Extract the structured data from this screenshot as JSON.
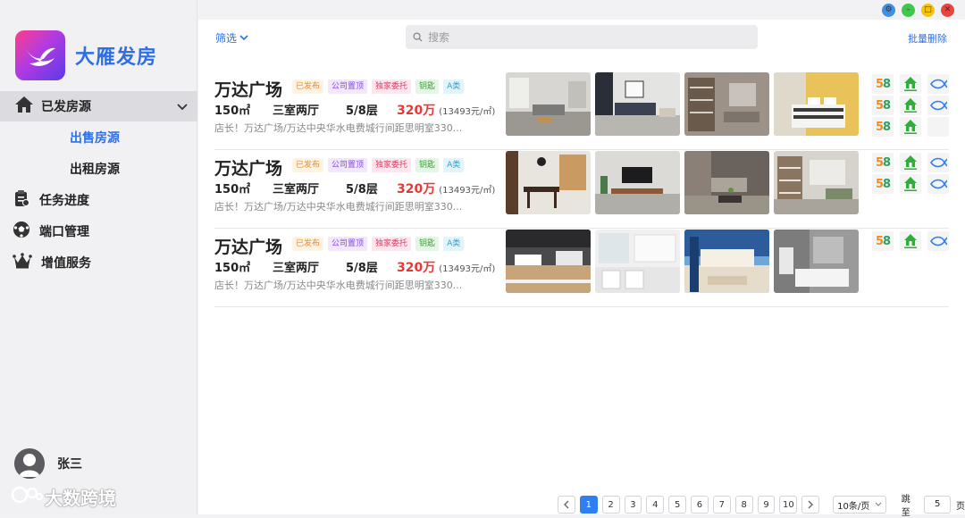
{
  "window": {
    "controls": [
      {
        "name": "settings-window-button",
        "color": "#3d8fe8",
        "glyph": "⚙"
      },
      {
        "name": "minimize-window-button",
        "color": "#3fc74a",
        "glyph": "–"
      },
      {
        "name": "maximize-window-button",
        "color": "#f2c40f",
        "glyph": "□"
      },
      {
        "name": "close-window-button",
        "color": "#e8453c",
        "glyph": "✕"
      }
    ]
  },
  "sidebar": {
    "brand": "大雁发房",
    "nav": {
      "group_label": "已发房源",
      "sub_items": [
        "出售房源",
        "出租房源"
      ],
      "items": [
        "任务进度",
        "端口管理",
        "增值服务"
      ]
    },
    "user_name": "张三",
    "watermark": "大数跨境"
  },
  "toolbar": {
    "filter_label": "筛选",
    "search_placeholder": "搜索",
    "bulk_delete_label": "批量删除"
  },
  "listings": [
    {
      "title": "万达广场",
      "tags": [
        "已发布",
        "公司置顶",
        "独家委托",
        "钥匙",
        "A类"
      ],
      "area": "150㎡",
      "layout": "三室两厅",
      "floor": "5/8层",
      "price": "320万",
      "unit_price": "(13493元/㎡)",
      "desc": "店长！万达广场/万达中央华水电费城行间距思明室330...",
      "photos": [
        "living-room",
        "living-room-dark",
        "study-shelves",
        "bedroom"
      ],
      "platforms": [
        [
          "58",
          "anjuke",
          "fish"
        ],
        [
          "58",
          "anjuke",
          "fish"
        ],
        [
          "58",
          "anjuke",
          ""
        ]
      ]
    },
    {
      "title": "万达广场",
      "tags": [
        "已发布",
        "公司置顶",
        "独家委托",
        "钥匙",
        "A类"
      ],
      "area": "150㎡",
      "layout": "三室两厅",
      "floor": "5/8层",
      "price": "320万",
      "unit_price": "(13493元/㎡)",
      "desc": "店长！万达广场/万达中央华水电费城行间距思明室330...",
      "photos": [
        "dining",
        "tv-wall",
        "lounge",
        "shelves"
      ],
      "platforms": [
        [
          "58",
          "anjuke",
          "fish"
        ],
        [
          "58",
          "anjuke",
          "fish"
        ]
      ]
    },
    {
      "title": "万达广场",
      "tags": [
        "已发布",
        "公司置顶",
        "独家委托",
        "钥匙",
        "A类"
      ],
      "area": "150㎡",
      "layout": "三室两厅",
      "floor": "5/8层",
      "price": "320万",
      "unit_price": "(13493元/㎡)",
      "desc": "店长！万达广场/万达中央华水电费城行间距思明室330...",
      "photos": [
        "kitchen-dark",
        "kitchen-white",
        "kids-room",
        "bathroom"
      ],
      "platforms": [
        [
          "58",
          "anjuke",
          "fish"
        ]
      ]
    }
  ],
  "tag_colors": [
    {
      "fg": "#f08a24",
      "bg": "#fff3e3"
    },
    {
      "fg": "#8a4ae0",
      "bg": "#f1e8fd"
    },
    {
      "fg": "#e53965",
      "bg": "#fde6ed"
    },
    {
      "fg": "#3aa53a",
      "bg": "#e6f6e6"
    },
    {
      "fg": "#2aa3d8",
      "bg": "#e3f4fb"
    }
  ],
  "pagination": {
    "pages": [
      "1",
      "2",
      "3",
      "4",
      "5",
      "6",
      "7",
      "8",
      "9",
      "10"
    ],
    "current": "1",
    "page_size": "10条/页",
    "jump_label": "跳至",
    "jump_value": "5",
    "page_suffix": "页"
  },
  "colors": {
    "accent": "#2f6fe6",
    "price": "#e53935"
  }
}
